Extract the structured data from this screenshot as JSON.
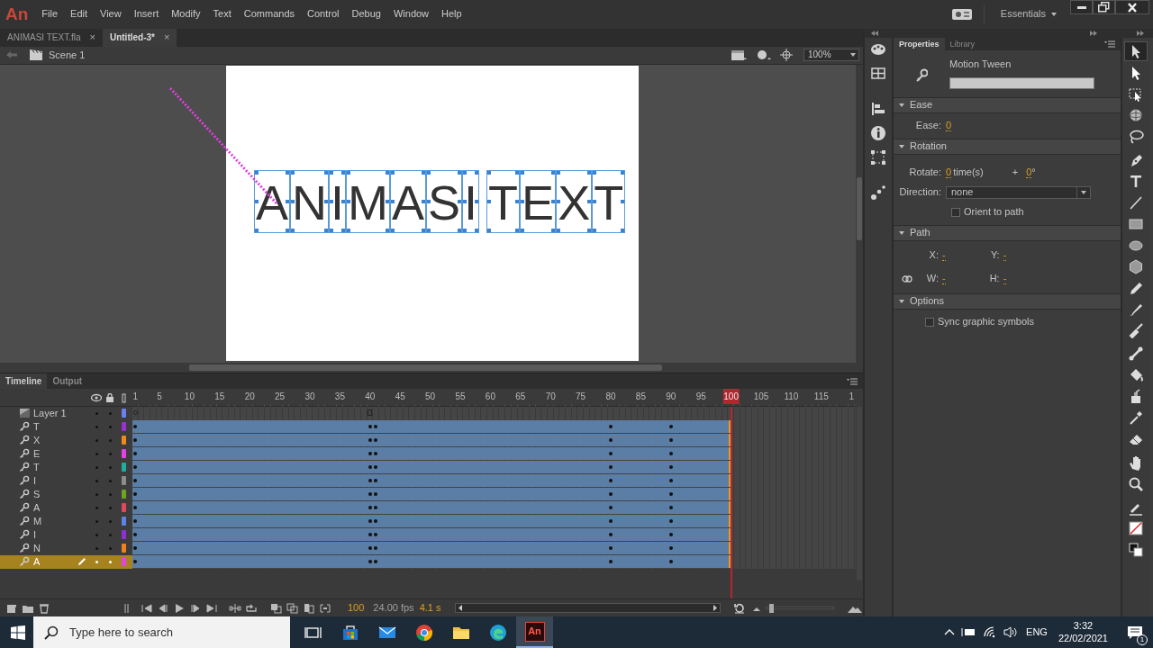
{
  "app": {
    "logo": "An",
    "menu": [
      "File",
      "Edit",
      "View",
      "Insert",
      "Modify",
      "Text",
      "Commands",
      "Control",
      "Debug",
      "Window",
      "Help"
    ],
    "workspace": "Essentials"
  },
  "doc_tabs": [
    {
      "label": "ANIMASI TEXT.fla",
      "close": "×",
      "selected": false
    },
    {
      "label": "Untitled-3*",
      "close": "×",
      "selected": true
    }
  ],
  "edit_bar": {
    "scene": "Scene 1",
    "zoom": "100%"
  },
  "stage": {
    "words": [
      [
        "A",
        "N",
        "I",
        "M",
        "A",
        "S",
        "I"
      ],
      [
        "T",
        "E",
        "X",
        "T"
      ]
    ]
  },
  "timeline": {
    "tabs": [
      {
        "label": "Timeline",
        "selected": true
      },
      {
        "label": "Output",
        "selected": false
      }
    ],
    "ruler": [
      {
        "label": "1",
        "selected": false
      },
      {
        "label": "5",
        "selected": false
      },
      {
        "label": "10",
        "selected": false
      },
      {
        "label": "15",
        "selected": false
      },
      {
        "label": "20",
        "selected": false
      },
      {
        "label": "25",
        "selected": false
      },
      {
        "label": "30",
        "selected": false
      },
      {
        "label": "35",
        "selected": false
      },
      {
        "label": "40",
        "selected": false
      },
      {
        "label": "45",
        "selected": false
      },
      {
        "label": "50",
        "selected": false
      },
      {
        "label": "55",
        "selected": false
      },
      {
        "label": "60",
        "selected": false
      },
      {
        "label": "65",
        "selected": false
      },
      {
        "label": "70",
        "selected": false
      },
      {
        "label": "75",
        "selected": false
      },
      {
        "label": "80",
        "selected": false
      },
      {
        "label": "85",
        "selected": false
      },
      {
        "label": "90",
        "selected": false
      },
      {
        "label": "95",
        "selected": false
      },
      {
        "label": "100",
        "selected": true
      },
      {
        "label": "105",
        "selected": false
      },
      {
        "label": "110",
        "selected": false
      },
      {
        "label": "115",
        "selected": false
      },
      {
        "label": "1",
        "selected": false
      }
    ],
    "layers": [
      {
        "name": "Layer 1",
        "kind": "normal",
        "color": "#6b7ff0",
        "selected": false,
        "marks": [
          {
            "kind": "empty_keyframe",
            "level": 0
          },
          {
            "kind": "frame_end",
            "level": 0.325
          }
        ]
      },
      {
        "name": "T",
        "kind": "tween",
        "color": "#9a2fd4",
        "selected": false,
        "tween": {
          "level": 0.8333
        },
        "marks": [
          {
            "kind": "keyframe",
            "level": 0
          },
          {
            "kind": "keyframe",
            "level": 0.325
          },
          {
            "kind": "keyframe",
            "level": 0.3333
          },
          {
            "kind": "keyframe",
            "level": 0.6583
          },
          {
            "kind": "keyframe",
            "level": 0.7417
          }
        ]
      },
      {
        "name": "X",
        "kind": "tween",
        "color": "#ec8a1c",
        "selected": false,
        "tween": {
          "level": 0.8333
        },
        "marks": [
          {
            "kind": "keyframe",
            "level": 0
          },
          {
            "kind": "keyframe",
            "level": 0.325
          },
          {
            "kind": "keyframe",
            "level": 0.3333
          },
          {
            "kind": "keyframe",
            "level": 0.6583
          },
          {
            "kind": "keyframe",
            "level": 0.7417
          }
        ]
      },
      {
        "name": "E",
        "kind": "tween",
        "color": "#e442e4",
        "selected": false,
        "tween": {
          "level": 0.8333
        },
        "marks": [
          {
            "kind": "keyframe",
            "level": 0
          },
          {
            "kind": "keyframe",
            "level": 0.325
          },
          {
            "kind": "keyframe",
            "level": 0.3333
          },
          {
            "kind": "keyframe",
            "level": 0.6583
          },
          {
            "kind": "keyframe",
            "level": 0.7417
          }
        ]
      },
      {
        "name": "T",
        "kind": "tween",
        "color": "#1fae9c",
        "selected": false,
        "tween": {
          "level": 0.8333
        },
        "marks": [
          {
            "kind": "keyframe",
            "level": 0
          },
          {
            "kind": "keyframe",
            "level": 0.325
          },
          {
            "kind": "keyframe",
            "level": 0.3333
          },
          {
            "kind": "keyframe",
            "level": 0.6583
          },
          {
            "kind": "keyframe",
            "level": 0.7417
          }
        ]
      },
      {
        "name": "I",
        "kind": "tween",
        "color": "#8c8c8c",
        "selected": false,
        "tween": {
          "level": 0.8333
        },
        "marks": [
          {
            "kind": "keyframe",
            "level": 0
          },
          {
            "kind": "keyframe",
            "level": 0.325
          },
          {
            "kind": "keyframe",
            "level": 0.3333
          },
          {
            "kind": "keyframe",
            "level": 0.6583
          },
          {
            "kind": "keyframe",
            "level": 0.7417
          }
        ]
      },
      {
        "name": "S",
        "kind": "tween",
        "color": "#6ea324",
        "selected": false,
        "tween": {
          "level": 0.8333
        },
        "marks": [
          {
            "kind": "keyframe",
            "level": 0
          },
          {
            "kind": "keyframe",
            "level": 0.325
          },
          {
            "kind": "keyframe",
            "level": 0.3333
          },
          {
            "kind": "keyframe",
            "level": 0.6583
          },
          {
            "kind": "keyframe",
            "level": 0.7417
          }
        ]
      },
      {
        "name": "A",
        "kind": "tween",
        "color": "#e2475a",
        "selected": false,
        "tween": {
          "level": 0.8333
        },
        "marks": [
          {
            "kind": "keyframe",
            "level": 0
          },
          {
            "kind": "keyframe",
            "level": 0.325
          },
          {
            "kind": "keyframe",
            "level": 0.3333
          },
          {
            "kind": "keyframe",
            "level": 0.6583
          },
          {
            "kind": "keyframe",
            "level": 0.7417
          }
        ]
      },
      {
        "name": "M",
        "kind": "tween",
        "color": "#5f82e6",
        "selected": false,
        "tween": {
          "level": 0.8333
        },
        "marks": [
          {
            "kind": "keyframe",
            "level": 0
          },
          {
            "kind": "keyframe",
            "level": 0.325
          },
          {
            "kind": "keyframe",
            "level": 0.3333
          },
          {
            "kind": "keyframe",
            "level": 0.6583
          },
          {
            "kind": "keyframe",
            "level": 0.7417
          }
        ]
      },
      {
        "name": "I",
        "kind": "tween",
        "color": "#8f30d6",
        "selected": false,
        "tween": {
          "level": 0.8333
        },
        "marks": [
          {
            "kind": "keyframe",
            "level": 0
          },
          {
            "kind": "keyframe",
            "level": 0.325
          },
          {
            "kind": "keyframe",
            "level": 0.3333
          },
          {
            "kind": "keyframe",
            "level": 0.6583
          },
          {
            "kind": "keyframe",
            "level": 0.7417
          }
        ]
      },
      {
        "name": "N",
        "kind": "tween",
        "color": "#f08020",
        "selected": false,
        "tween": {
          "level": 0.8333
        },
        "marks": [
          {
            "kind": "keyframe",
            "level": 0
          },
          {
            "kind": "keyframe",
            "level": 0.325
          },
          {
            "kind": "keyframe",
            "level": 0.3333
          },
          {
            "kind": "keyframe",
            "level": 0.6583
          },
          {
            "kind": "keyframe",
            "level": 0.7417
          }
        ]
      },
      {
        "name": "A",
        "kind": "tween",
        "color": "#e046d8",
        "selected": true,
        "tween": {
          "level": 0.8333
        },
        "marks": [
          {
            "kind": "keyframe",
            "level": 0
          },
          {
            "kind": "keyframe",
            "level": 0.325
          },
          {
            "kind": "keyframe",
            "level": 0.3333
          },
          {
            "kind": "keyframe",
            "level": 0.6583
          },
          {
            "kind": "keyframe",
            "level": 0.7417
          }
        ]
      }
    ],
    "status": {
      "frame": "100",
      "fps": "24.00 fps",
      "time": "4.1 s"
    },
    "zoom_slider": {
      "level": 0.05
    }
  },
  "properties": {
    "tabs": [
      {
        "label": "Properties",
        "selected": true
      },
      {
        "label": "Library",
        "selected": false
      }
    ],
    "type": "Motion Tween",
    "sections": [
      {
        "title": "Ease",
        "kind": "ease",
        "expanded": true,
        "label": "Ease:",
        "value": "0"
      },
      {
        "title": "Rotation",
        "kind": "rotation",
        "expanded": true,
        "rotate_label": "Rotate:",
        "times": "0",
        "times_unit": "time(s)",
        "plus": "+",
        "degrees": "0",
        "degree_unit": "°",
        "direction_label": "Direction:",
        "direction": "none",
        "orient": {
          "label": "Orient to path",
          "checked": false
        }
      },
      {
        "title": "Path",
        "kind": "path",
        "expanded": true,
        "fields": [
          {
            "label": "X:",
            "value": "-"
          },
          {
            "label": "Y:",
            "value": "-"
          },
          {
            "label": "W:",
            "value": "-"
          },
          {
            "label": "H:",
            "value": "-"
          }
        ]
      },
      {
        "title": "Options",
        "kind": "options",
        "expanded": true,
        "sync": {
          "label": "Sync graphic symbols",
          "checked": false
        }
      }
    ]
  },
  "tools": [
    {
      "kind": "selection",
      "selected": true
    },
    {
      "kind": "subselection",
      "selected": false
    },
    {
      "kind": "transform",
      "selected": false
    },
    {
      "kind": "rotate3d",
      "selected": false
    },
    {
      "kind": "lasso",
      "selected": false
    },
    {
      "kind": "pen",
      "selected": false
    },
    {
      "kind": "text",
      "selected": false
    },
    {
      "kind": "line",
      "selected": false
    },
    {
      "kind": "rectangle",
      "selected": false
    },
    {
      "kind": "oval",
      "selected": false
    },
    {
      "kind": "polygon",
      "selected": false
    },
    {
      "kind": "pencil",
      "selected": false
    },
    {
      "kind": "brush",
      "selected": false
    },
    {
      "kind": "paintbrush",
      "selected": false
    },
    {
      "kind": "bone",
      "selected": false
    },
    {
      "kind": "bucket",
      "selected": false
    },
    {
      "kind": "ink",
      "selected": false
    },
    {
      "kind": "eyedropper",
      "selected": false
    },
    {
      "kind": "eraser",
      "selected": false
    },
    {
      "kind": "hand",
      "selected": false
    },
    {
      "kind": "zoom",
      "selected": false
    },
    {
      "kind": "stroke",
      "selected": false
    },
    {
      "kind": "fill",
      "selected": false
    },
    {
      "kind": "swap",
      "selected": false
    }
  ],
  "taskbar": {
    "search_placeholder": "Type here to search",
    "apps": [
      {
        "kind": "task-view",
        "selected": false
      },
      {
        "kind": "store",
        "selected": false
      },
      {
        "kind": "mail",
        "selected": false
      },
      {
        "kind": "chrome",
        "selected": false
      },
      {
        "kind": "explorer",
        "selected": false
      },
      {
        "kind": "edge",
        "selected": false
      },
      {
        "kind": "animate",
        "label": "An",
        "selected": true
      }
    ],
    "language": "ENG",
    "time": "3:32",
    "date": "22/02/2021",
    "notifications": "1"
  }
}
